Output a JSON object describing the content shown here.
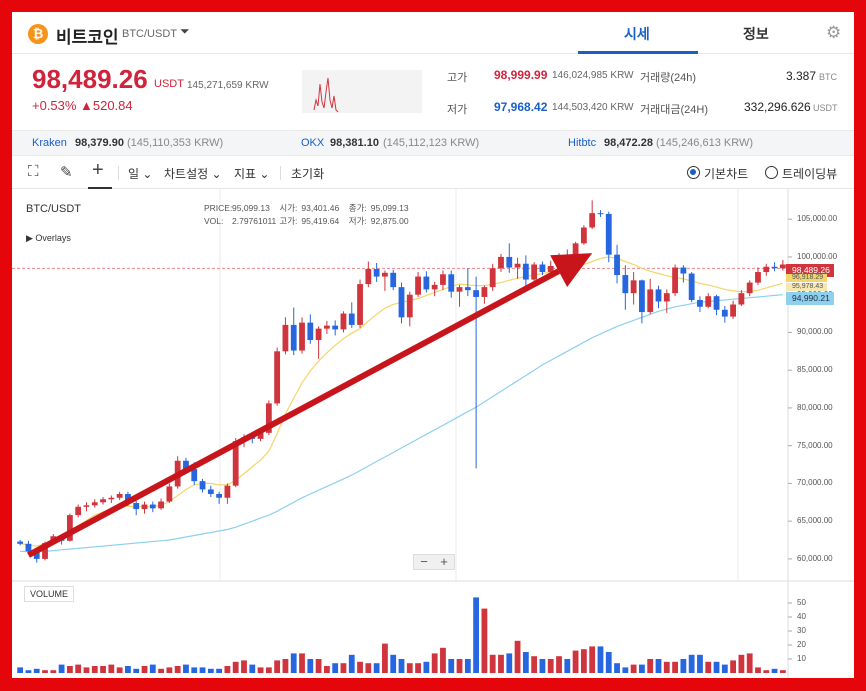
{
  "header": {
    "coin_symbol_glyph": "₿",
    "coin_name": "비트코인",
    "pair": "BTC/USDT",
    "caret": "⏷",
    "tab_price": "시세",
    "tab_info": "정보",
    "gear": "⚙"
  },
  "summary": {
    "price": "98,489.26",
    "unit": "USDT",
    "price_krw": "145,271,659",
    "price_krw_unit": "KRW",
    "change_pct": "+0.53%",
    "change_amt": "▲520.84",
    "high_label": "고가",
    "high_value": "98,999.99",
    "high_krw": "146,024,985",
    "low_label": "저가",
    "low_value": "97,968.42",
    "low_krw": "144,503,420",
    "krw_unit": "KRW",
    "vol24_label": "거래량(24h)",
    "vol24_value": "3.387",
    "vol24_unit": "BTC",
    "amt24_label": "거래대금(24H)",
    "amt24_value": "332,296.626",
    "amt24_unit": "USDT"
  },
  "exchanges": [
    {
      "name": "Kraken",
      "value": "98,379.90",
      "krw": "(145,110,353 KRW)"
    },
    {
      "name": "OKX",
      "value": "98,381.10",
      "krw": "(145,112,123 KRW)"
    },
    {
      "name": "Hitbtc",
      "value": "98,472.28",
      "krw": "(145,246,613 KRW)"
    }
  ],
  "toolbar": {
    "fullscreen_icon": "⛶",
    "pencil_icon": "✎",
    "crosshair_icon": "+",
    "interval": "일",
    "chart_settings": "차트설정",
    "indicators": "지표",
    "reset": "초기화",
    "basic_chart": "기본차트",
    "tradingview": "트레이딩뷰",
    "selected_view": "기본차트"
  },
  "chart": {
    "symbol": "BTC/USDT",
    "overlays": "▶ Overlays",
    "price_label": "PRICE:",
    "price_val": "95,099.13",
    "open_label": "시가:",
    "open_val": "93,401.46",
    "close_label": "종가:",
    "close_val": "95,099.13",
    "vol_label": "VOL:",
    "vol_val": "2.79761011",
    "high_label": "고가:",
    "high_val": "95,419.64",
    "low_label": "저가:",
    "low_val": "92,875.00",
    "volume_title": "VOLUME",
    "zoom_out": "−",
    "zoom_in": "+",
    "tag_current": "98,489.26",
    "tag_ma1": "96,918.29",
    "tag_ma2": "95,978.43",
    "tag_ma3": "94,990.21"
  },
  "chart_data": {
    "type": "candlestick",
    "ylim": [
      58000,
      109000
    ],
    "price_ticks": [
      105000,
      100000,
      95000,
      90000,
      85000,
      80000,
      75000,
      70000,
      65000,
      60000
    ],
    "volume_ticks": [
      10,
      20,
      30,
      40,
      50
    ],
    "colors": {
      "up": "#d0343d",
      "down": "#2667e0",
      "ma_short": "#f4d56a",
      "ma_long": "#8fd0ee",
      "arrow": "#c8151b"
    },
    "candles": [
      [
        62300,
        62500,
        61800,
        62000
      ],
      [
        62000,
        62400,
        60800,
        61000
      ],
      [
        61000,
        61300,
        59500,
        60000
      ],
      [
        60000,
        62300,
        59800,
        62100
      ],
      [
        62100,
        63300,
        61900,
        63000
      ],
      [
        63000,
        63200,
        61900,
        62400
      ],
      [
        62400,
        66000,
        62300,
        65800
      ],
      [
        65800,
        67200,
        65500,
        66900
      ],
      [
        66900,
        67500,
        66300,
        67100
      ],
      [
        67100,
        67900,
        66800,
        67500
      ],
      [
        67500,
        68200,
        67200,
        67900
      ],
      [
        67900,
        68400,
        67400,
        68100
      ],
      [
        68100,
        68900,
        67800,
        68600
      ],
      [
        68600,
        68900,
        67000,
        67400
      ],
      [
        67400,
        67700,
        65800,
        66600
      ],
      [
        66600,
        67600,
        66000,
        67200
      ],
      [
        67200,
        67600,
        66200,
        66700
      ],
      [
        66700,
        68000,
        66500,
        67600
      ],
      [
        67600,
        70000,
        67400,
        69600
      ],
      [
        69600,
        73600,
        69300,
        73000
      ],
      [
        73000,
        73400,
        71500,
        71900
      ],
      [
        71900,
        72800,
        69800,
        70300
      ],
      [
        70300,
        70600,
        68800,
        69200
      ],
      [
        69200,
        69700,
        68200,
        68600
      ],
      [
        68600,
        68900,
        67300,
        68100
      ],
      [
        68100,
        70000,
        67300,
        69700
      ],
      [
        69700,
        76000,
        69500,
        75600
      ],
      [
        75600,
        76500,
        74800,
        76100
      ],
      [
        76100,
        76600,
        75300,
        75900
      ],
      [
        75900,
        77000,
        75600,
        76700
      ],
      [
        76700,
        81000,
        76400,
        80600
      ],
      [
        80600,
        88000,
        80300,
        87500
      ],
      [
        87500,
        92000,
        87100,
        91000
      ],
      [
        91000,
        93300,
        87000,
        87600
      ],
      [
        87600,
        92000,
        87200,
        91300
      ],
      [
        91300,
        92400,
        88500,
        89000
      ],
      [
        89000,
        90800,
        86500,
        90500
      ],
      [
        90500,
        91500,
        89800,
        90900
      ],
      [
        90900,
        91600,
        89600,
        90400
      ],
      [
        90400,
        92800,
        90000,
        92500
      ],
      [
        92500,
        94000,
        90600,
        91000
      ],
      [
        91000,
        97000,
        90600,
        96400
      ],
      [
        96400,
        99400,
        96000,
        98400
      ],
      [
        98400,
        99200,
        96700,
        97400
      ],
      [
        97400,
        98200,
        95500,
        97900
      ],
      [
        97900,
        98300,
        95600,
        96000
      ],
      [
        96000,
        96600,
        91200,
        92000
      ],
      [
        92000,
        95400,
        90800,
        95000
      ],
      [
        95000,
        98000,
        94700,
        97400
      ],
      [
        97400,
        98100,
        95300,
        95700
      ],
      [
        95700,
        96700,
        94800,
        96300
      ],
      [
        96300,
        98200,
        95600,
        97700
      ],
      [
        97700,
        98200,
        94600,
        95400
      ],
      [
        95400,
        96300,
        93400,
        96000
      ],
      [
        96000,
        98500,
        94800,
        95600
      ],
      [
        95600,
        97400,
        72000,
        94700
      ],
      [
        94700,
        96200,
        93800,
        96000
      ],
      [
        96000,
        99100,
        95500,
        98500
      ],
      [
        98500,
        100400,
        98000,
        100000
      ],
      [
        100000,
        101800,
        97900,
        98600
      ],
      [
        98600,
        99900,
        97100,
        99100
      ],
      [
        99100,
        100200,
        96100,
        97000
      ],
      [
        97000,
        99300,
        96600,
        99000
      ],
      [
        99000,
        99400,
        97600,
        98000
      ],
      [
        98000,
        99500,
        97500,
        98800
      ],
      [
        98800,
        100500,
        98500,
        100200
      ],
      [
        100200,
        101000,
        98600,
        99300
      ],
      [
        99300,
        102000,
        99100,
        101800
      ],
      [
        101800,
        104200,
        101600,
        103900
      ],
      [
        103900,
        107500,
        103700,
        105800
      ],
      [
        105800,
        106200,
        105300,
        105700
      ],
      [
        105700,
        106000,
        99300,
        100300
      ],
      [
        100300,
        101600,
        96500,
        97600
      ],
      [
        97600,
        98900,
        93000,
        95200
      ],
      [
        95200,
        98000,
        93700,
        96900
      ],
      [
        96900,
        97000,
        91200,
        92700
      ],
      [
        92700,
        97100,
        92400,
        95700
      ],
      [
        95700,
        96200,
        93200,
        94100
      ],
      [
        94100,
        95700,
        92600,
        95200
      ],
      [
        95200,
        99000,
        94800,
        98600
      ],
      [
        98600,
        98900,
        96600,
        97800
      ],
      [
        97800,
        98000,
        94000,
        94300
      ],
      [
        94300,
        94800,
        92700,
        93400
      ],
      [
        93400,
        95200,
        93200,
        94800
      ],
      [
        94800,
        95000,
        92300,
        93000
      ],
      [
        93000,
        93500,
        91300,
        92100
      ],
      [
        92100,
        94200,
        91800,
        93700
      ],
      [
        93700,
        95600,
        93500,
        95200
      ],
      [
        95200,
        96900,
        94800,
        96600
      ],
      [
        96600,
        98600,
        96300,
        98000
      ],
      [
        98000,
        99100,
        97500,
        98700
      ],
      [
        98700,
        99300,
        98100,
        98500
      ],
      [
        98500,
        99600,
        98200,
        99000
      ]
    ],
    "volumes": [
      4,
      2,
      3,
      2,
      2,
      6,
      5,
      6,
      4,
      5,
      5,
      6,
      4,
      5,
      3,
      5,
      6,
      3,
      4,
      5,
      6,
      4,
      4,
      3,
      3,
      5,
      8,
      9,
      6,
      4,
      4,
      9,
      10,
      14,
      14,
      10,
      10,
      5,
      7,
      7,
      13,
      8,
      7,
      7,
      21,
      13,
      10,
      7,
      7,
      8,
      14,
      18,
      10,
      10,
      10,
      54,
      46,
      13,
      13,
      14,
      23,
      15,
      12,
      10,
      10,
      12,
      10,
      16,
      17,
      19,
      19,
      15,
      7,
      4,
      6,
      6,
      10,
      10,
      8,
      8,
      10,
      13,
      13,
      8,
      8,
      6,
      9,
      13,
      14,
      4,
      2,
      3,
      2
    ],
    "ma_short": [
      62000,
      61900,
      61700,
      62000,
      62500,
      62900,
      63600,
      64400,
      65100,
      65800,
      66200,
      66600,
      66900,
      67000,
      66900,
      66900,
      66900,
      67100,
      67600,
      68400,
      69200,
      69800,
      70000,
      70000,
      69800,
      69800,
      70400,
      71300,
      72200,
      73100,
      74300,
      76600,
      79200,
      81300,
      83300,
      84900,
      86200,
      87300,
      88300,
      89200,
      89900,
      90500,
      91500,
      92400,
      93200,
      93700,
      94000,
      94200,
      94500,
      94900,
      95300,
      95700,
      96100,
      96400,
      96300,
      96200,
      96200,
      96400,
      96600,
      96900,
      97200,
      97400,
      97600,
      97800,
      98000,
      98200,
      98400,
      98600,
      99000,
      99400,
      99800,
      100000,
      99800,
      99400,
      99000,
      98500,
      98100,
      97800,
      97500,
      97300,
      97100,
      96800,
      96500,
      96300,
      96000,
      95700,
      95500,
      95400,
      95400,
      95600,
      95900,
      96200,
      96500
    ],
    "ma_long": [
      61000,
      61000,
      61000,
      61000,
      61100,
      61200,
      61300,
      61400,
      61500,
      61600,
      61700,
      61800,
      61900,
      62000,
      62100,
      62200,
      62300,
      62400,
      62500,
      62700,
      62900,
      63100,
      63300,
      63500,
      63700,
      63900,
      64200,
      64600,
      65000,
      65400,
      65800,
      66300,
      66900,
      67500,
      68100,
      68600,
      69100,
      69600,
      70100,
      70600,
      71100,
      71700,
      72300,
      72900,
      73500,
      74100,
      74700,
      75300,
      75900,
      76500,
      77100,
      77700,
      78300,
      78900,
      79500,
      80100,
      80800,
      81500,
      82200,
      82900,
      83600,
      84300,
      85000,
      85700,
      86300,
      86900,
      87500,
      88100,
      88700,
      89300,
      89800,
      90300,
      90800,
      91200,
      91600,
      92000,
      92400,
      92800,
      93100,
      93400,
      93600,
      93800,
      94000,
      94100,
      94200,
      94300,
      94400,
      94500,
      94600,
      94700,
      94800,
      94900,
      95000
    ],
    "current_price": 98489.26,
    "arrow_from": [
      1,
      60500
    ],
    "arrow_to": [
      69,
      100500
    ]
  }
}
